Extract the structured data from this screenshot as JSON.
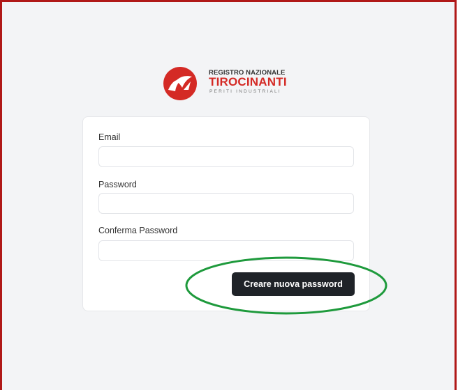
{
  "logo": {
    "line1": "REGISTRO NAZIONALE",
    "line2": "TIROCINANTI",
    "line3": "PERITI INDUSTRIALI",
    "brand_color": "#d42a25"
  },
  "form": {
    "email_label": "Email",
    "email_value": "",
    "password_label": "Password",
    "password_value": "",
    "confirm_label": "Conferma Password",
    "confirm_value": "",
    "submit_label": "Creare nuova password"
  },
  "colors": {
    "frame_border": "#b01818",
    "page_background": "#f3f4f6",
    "button_background": "#1f2328",
    "highlight_ellipse": "#1e9a3c"
  }
}
